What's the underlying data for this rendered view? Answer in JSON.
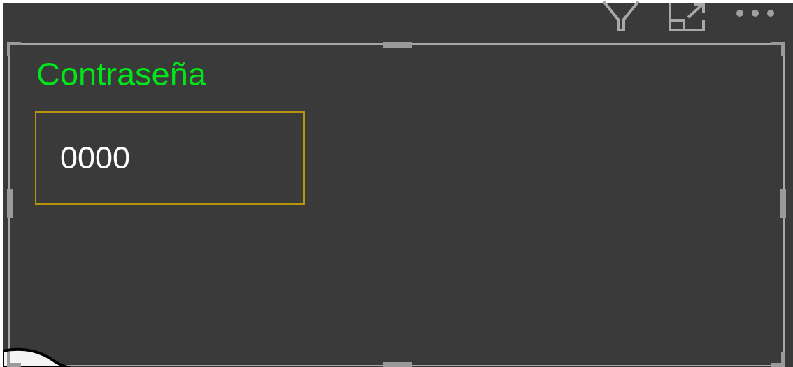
{
  "visual": {
    "selected": true,
    "title": "Contraseña",
    "field": {
      "value": "0000"
    }
  }
}
